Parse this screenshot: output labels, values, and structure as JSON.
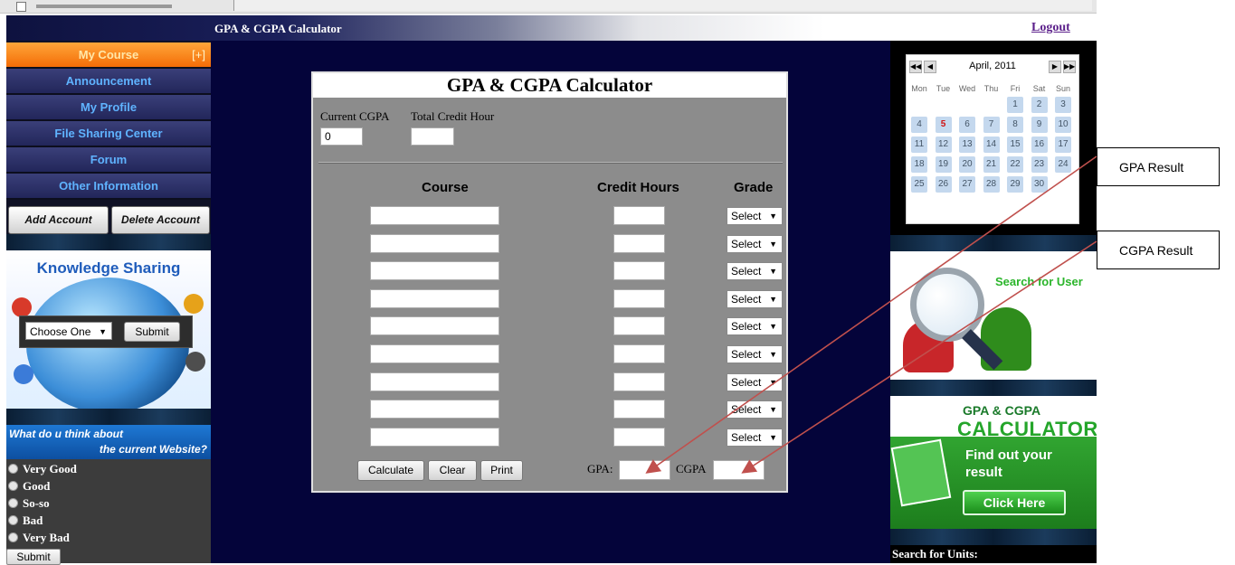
{
  "header": {
    "title": "GPA & CGPA Calculator",
    "logout": "Logout"
  },
  "sidebar": {
    "nav": [
      {
        "label": "My Course",
        "marker": "[+]"
      },
      {
        "label": "Announcement"
      },
      {
        "label": "My Profile"
      },
      {
        "label": "File Sharing Center"
      },
      {
        "label": "Forum"
      },
      {
        "label": "Other Information"
      }
    ],
    "add_account": "Add Account",
    "delete_account": "Delete Account",
    "knowledge": {
      "title": "Knowledge Sharing",
      "select_value": "Choose One",
      "submit": "Submit"
    },
    "poll": {
      "line1": "What do u think about",
      "line2": "the current Website?",
      "options": [
        "Very Good",
        "Good",
        "So-so",
        "Bad",
        "Very Bad"
      ],
      "submit": "Submit"
    }
  },
  "calculator": {
    "title": "GPA & CGPA Calculator",
    "current_cgpa_label": "Current CGPA",
    "current_cgpa_value": "0",
    "total_credit_label": "Total Credit Hour",
    "total_credit_value": "",
    "headers": {
      "course": "Course",
      "credit": "Credit Hours",
      "grade": "Grade"
    },
    "rows": [
      {
        "grade": "Select"
      },
      {
        "grade": "Select"
      },
      {
        "grade": "Select"
      },
      {
        "grade": "Select"
      },
      {
        "grade": "Select"
      },
      {
        "grade": "Select"
      },
      {
        "grade": "Select"
      },
      {
        "grade": "Select"
      },
      {
        "grade": "Select"
      }
    ],
    "buttons": {
      "calculate": "Calculate",
      "clear": "Clear",
      "print": "Print"
    },
    "gpa_label": "GPA:",
    "cgpa_label": "CGPA"
  },
  "calendar": {
    "month": "April, 2011",
    "prev_year": "◀◀",
    "prev": "◀",
    "next": "▶",
    "next_year": "▶▶",
    "dow": [
      "Mon",
      "Tue",
      "Wed",
      "Thu",
      "Fri",
      "Sat",
      "Sun"
    ],
    "days": [
      "1",
      "2",
      "3",
      "4",
      "5",
      "6",
      "7",
      "8",
      "9",
      "10",
      "11",
      "12",
      "13",
      "14",
      "15",
      "16",
      "17",
      "18",
      "19",
      "20",
      "21",
      "22",
      "23",
      "24",
      "25",
      "26",
      "27",
      "28",
      "29",
      "30"
    ],
    "today": "5",
    "first_weekday_index": 4
  },
  "right": {
    "search_users": "Search for User",
    "gpa_ad": {
      "line1": "GPA & CGPA",
      "line2": "CALCULATOR",
      "line3": "Find out your",
      "line4": "result",
      "button": "Click Here"
    },
    "search_units": "Search for Units:"
  },
  "annotations": {
    "gpa_result": "GPA Result",
    "cgpa_result": "CGPA Result"
  },
  "colors": {
    "arrow": "#c0504d",
    "nav_text": "#5fb3ff",
    "active_nav": "#f46d07",
    "main_bg": "#04043a"
  }
}
